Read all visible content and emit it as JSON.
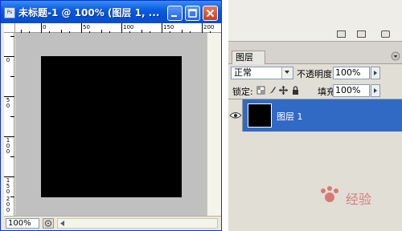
{
  "window": {
    "title": "未标题-1 @ 100% (图层 1, ...",
    "app_icon": "Ps"
  },
  "rulers": {
    "top_labels": [
      "0",
      "50",
      "100",
      "150",
      "200"
    ],
    "left_labels": [
      "0",
      "5\n0",
      "1\n0\n0",
      "1\n5\n0",
      "2\n0\n0"
    ]
  },
  "status": {
    "zoom": "100%"
  },
  "layers_panel": {
    "tab_label": "图层",
    "blend_mode": "正常",
    "opacity_label": "不透明度:",
    "opacity_value": "100%",
    "lock_label": "锁定:",
    "fill_label": "填充:",
    "fill_value": "100%",
    "layers": [
      {
        "name": "图层 1",
        "visible": true,
        "selected": true
      }
    ]
  },
  "watermark": {
    "text": "经验"
  },
  "colors": {
    "selection": "#316ac5",
    "canvas": "#000000",
    "workspace": "#c0c0c0",
    "titlebar": "#0a5ee0"
  }
}
